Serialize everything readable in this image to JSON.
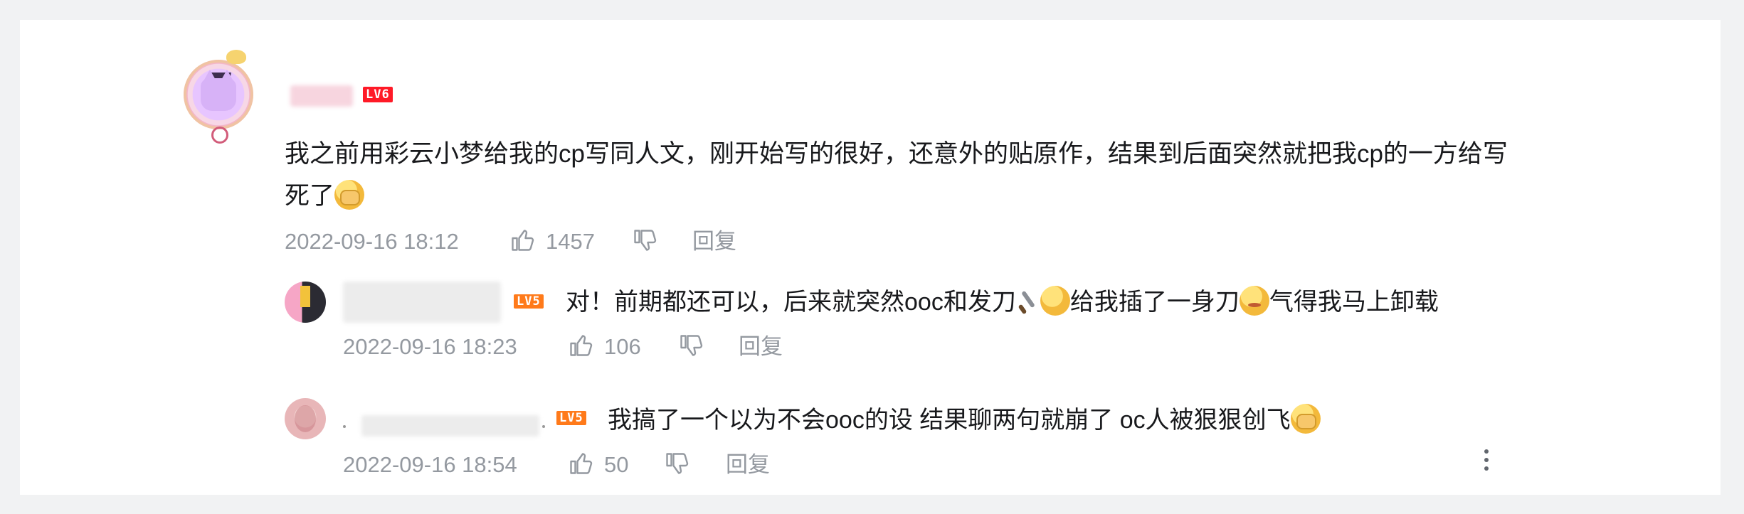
{
  "comment": {
    "text_line1": "我之前用彩云小梦给我的cp写同人文，刚开始写的很好，还意外的贴原作，结果到后面突然就把我cp的一方给写",
    "text_line2": "死了",
    "level_badge": "LV6",
    "time": "2022-09-16 18:12",
    "likes": "1457",
    "reply_label": "回复",
    "like_icon": "thumbs-up-icon",
    "dislike_icon": "thumbs-down-icon"
  },
  "replies": [
    {
      "level_badge": "LV5",
      "text_part1": "对！前期都还可以，后来就突然ooc和发刀",
      "text_part2": "给我插了一身刀",
      "text_part3": "气得我马上卸载",
      "time": "2022-09-16 18:23",
      "likes": "106",
      "reply_label": "回复"
    },
    {
      "level_badge": "LV5",
      "text": "我搞了一个以为不会ooc的设 结果聊两句就崩了 oc人被狠狠创飞",
      "time": "2022-09-16 18:54",
      "likes": "50",
      "reply_label": "回复"
    }
  ],
  "colors": {
    "background": "#f1f2f3",
    "card": "#ffffff",
    "text": "#18191c",
    "meta": "#9499a0",
    "lv6": "#ff1a27",
    "lv5": "#ff7a1a"
  }
}
